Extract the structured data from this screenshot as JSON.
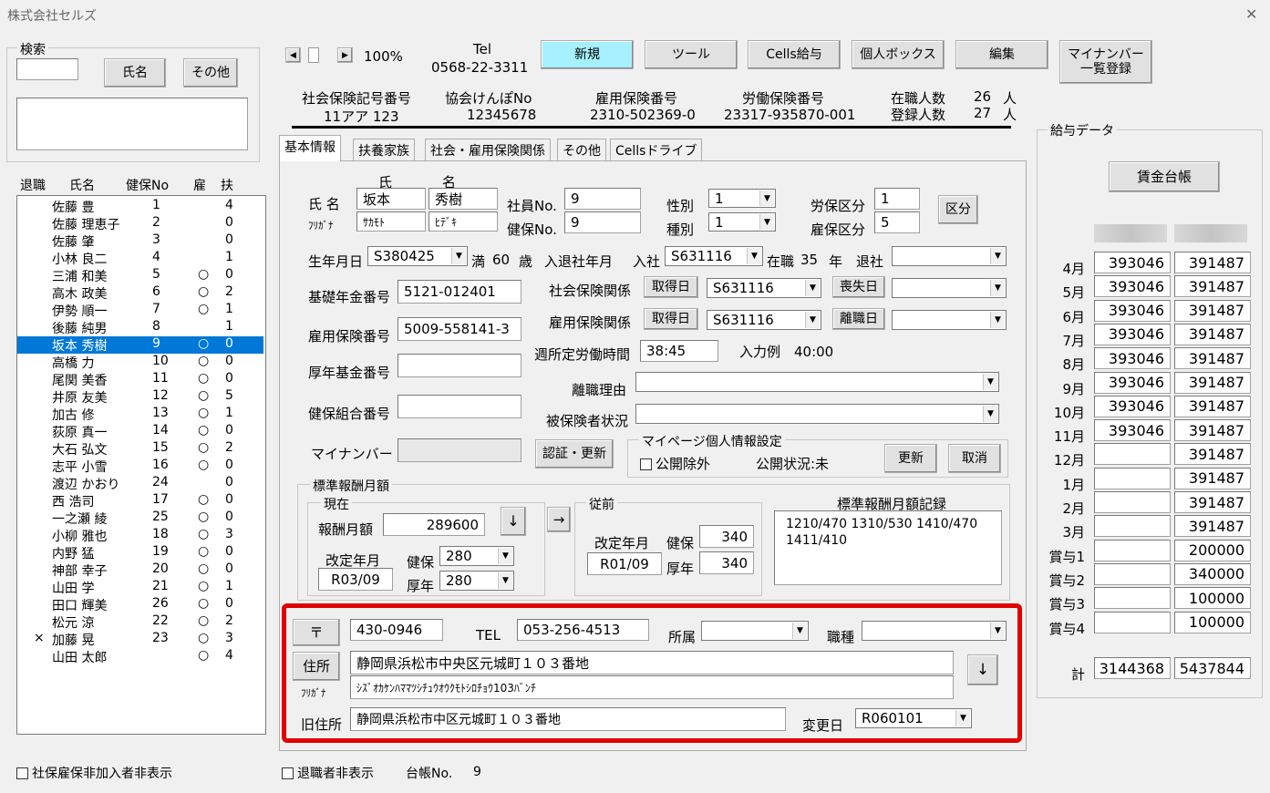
{
  "window": {
    "title": "株式会社セルズ",
    "close": "✕"
  },
  "search": {
    "title": "検索",
    "name_btn": "氏名",
    "other_btn": "その他",
    "input": ""
  },
  "list": {
    "headers": [
      "退職",
      "氏名",
      "健保No",
      "雇",
      "扶"
    ],
    "rows": [
      {
        "ret": "",
        "name": "佐藤 豊",
        "no": "1",
        "emp": "",
        "dep": "4"
      },
      {
        "ret": "",
        "name": "佐藤 理恵子",
        "no": "2",
        "emp": "",
        "dep": "0"
      },
      {
        "ret": "",
        "name": "佐藤 肇",
        "no": "3",
        "emp": "",
        "dep": "0"
      },
      {
        "ret": "",
        "name": "小林 良二",
        "no": "4",
        "emp": "",
        "dep": "1"
      },
      {
        "ret": "",
        "name": "三浦 和美",
        "no": "5",
        "emp": "○",
        "dep": "0"
      },
      {
        "ret": "",
        "name": "高木 政美",
        "no": "6",
        "emp": "○",
        "dep": "2"
      },
      {
        "ret": "",
        "name": "伊勢 順一",
        "no": "7",
        "emp": "○",
        "dep": "1"
      },
      {
        "ret": "",
        "name": "後藤 純男",
        "no": "8",
        "emp": "",
        "dep": "1"
      },
      {
        "ret": "",
        "name": "坂本 秀樹",
        "no": "9",
        "emp": "○",
        "dep": "0"
      },
      {
        "ret": "",
        "name": "高橋 力",
        "no": "10",
        "emp": "○",
        "dep": "0"
      },
      {
        "ret": "",
        "name": "尾関 美香",
        "no": "11",
        "emp": "○",
        "dep": "0"
      },
      {
        "ret": "",
        "name": "井原 友美",
        "no": "12",
        "emp": "○",
        "dep": "5"
      },
      {
        "ret": "",
        "name": "加古 修",
        "no": "13",
        "emp": "○",
        "dep": "1"
      },
      {
        "ret": "",
        "name": "荻原 真一",
        "no": "14",
        "emp": "○",
        "dep": "0"
      },
      {
        "ret": "",
        "name": "大石 弘文",
        "no": "15",
        "emp": "○",
        "dep": "2"
      },
      {
        "ret": "",
        "name": "志平 小雪",
        "no": "16",
        "emp": "○",
        "dep": "0"
      },
      {
        "ret": "",
        "name": "渡辺 かおり",
        "no": "24",
        "emp": "",
        "dep": "0"
      },
      {
        "ret": "",
        "name": "西 浩司",
        "no": "17",
        "emp": "○",
        "dep": "0"
      },
      {
        "ret": "",
        "name": "一之瀬 綾",
        "no": "25",
        "emp": "○",
        "dep": "0"
      },
      {
        "ret": "",
        "name": "小柳 雅也",
        "no": "18",
        "emp": "○",
        "dep": "3"
      },
      {
        "ret": "",
        "name": "内野 猛",
        "no": "19",
        "emp": "○",
        "dep": "0"
      },
      {
        "ret": "",
        "name": "神部 幸子",
        "no": "20",
        "emp": "○",
        "dep": "0"
      },
      {
        "ret": "",
        "name": "山田 学",
        "no": "21",
        "emp": "○",
        "dep": "1"
      },
      {
        "ret": "",
        "name": "田口 輝美",
        "no": "26",
        "emp": "○",
        "dep": "0"
      },
      {
        "ret": "",
        "name": "松元 涼",
        "no": "22",
        "emp": "○",
        "dep": "2"
      },
      {
        "ret": "×",
        "name": "加藤 晃",
        "no": "23",
        "emp": "○",
        "dep": "3"
      },
      {
        "ret": "",
        "name": "山田 太郎",
        "no": "",
        "emp": "○",
        "dep": "4"
      }
    ],
    "selected_index": 8
  },
  "bottom": {
    "hide_insured": "社保雇保非加入者非表示",
    "hide_retired": "退職者非表示",
    "ledger_label": "台帳No.",
    "ledger_no": "9"
  },
  "toolbar": {
    "zoom": "100%",
    "tel_label": "Tel",
    "tel": "0568-22-3311",
    "new": "新規",
    "tool": "ツール",
    "cells": "Cells給与",
    "personal": "個人ボックス",
    "edit": "編集",
    "mynumber": "マイナンバー\n一覧登録"
  },
  "company": {
    "sis_label": "社会保険記号番号",
    "sis": "11アア 123",
    "kenpo_label": "協会けんぽNo",
    "kenpo": "12345678",
    "koyo_label": "雇用保険番号",
    "koyo": "2310-502369-0",
    "rodo_label": "労働保険番号",
    "rodo": "23317-935870-001",
    "enrolled_label": "在職人数",
    "enrolled": "26",
    "registered_label": "登録人数",
    "registered": "27",
    "unit": "人"
  },
  "tabs": [
    "基本情報",
    "扶養家族",
    "社会・雇用保険関係",
    "その他",
    "Cellsドライブ"
  ],
  "basic": {
    "col_sei": "氏",
    "col_mei": "名",
    "name_label": "氏 名",
    "furi_label": "ﾌﾘｶﾞﾅ",
    "sei": "坂本",
    "mei": "秀樹",
    "sei_kana": "ｻｶﾓﾄ",
    "mei_kana": "ﾋﾃﾞｷ",
    "empno_label": "社員No.",
    "empno": "9",
    "kenpono_label": "健保No.",
    "kenpono": "9",
    "sex_label": "性別",
    "sex": "1",
    "kind_label": "種別",
    "kind": "1",
    "rodo_kbn_label": "労保区分",
    "rodo_kbn": "1",
    "koyo_kbn_label": "雇保区分",
    "koyo_kbn": "5",
    "kubun_btn": "区分",
    "birth_label": "生年月日",
    "birth": "S380425",
    "age_pre": "満",
    "age": "60",
    "age_unit": "歳",
    "join_label": "入退社年月",
    "join_pre": "入社",
    "join": "S631116",
    "years_pre": "在職",
    "years": "35",
    "years_unit": "年",
    "retire_label": "退社",
    "retire": "",
    "pension_label": "基礎年金番号",
    "pension": "5121-012401",
    "koyono_label": "雇用保険番号",
    "koyono": "5009-558141-3",
    "kosei_label": "厚年基金番号",
    "kosei": "",
    "kumiai_label": "健保組合番号",
    "kumiai": "",
    "mynum_label": "マイナンバー",
    "mynum": "",
    "auth_btn": "認証・更新",
    "shaho_label": "社会保険関係",
    "shaho_get": "取得日",
    "shaho_date": "S631116",
    "shaho_lost": "喪失日",
    "koyoh_label": "雇用保険関係",
    "koyoh_get": "取得日",
    "koyoh_date": "S631116",
    "koyoh_leave": "離職日",
    "hours_label": "週所定労働時間",
    "hours": "38:45",
    "hours_example": "入力例　40:00",
    "reason_label": "離職理由",
    "status_label": "被保険者状況",
    "mypage_title": "マイページ個人情報設定",
    "public_ex": "公開除外",
    "public_status": "公開状況:未",
    "update_btn": "更新",
    "cancel_btn": "取消"
  },
  "salary": {
    "title": "標準報酬月額",
    "cur_title": "現在",
    "pay_label": "報酬月額",
    "pay": "289600",
    "rev_label": "改定年月",
    "rev": "R03/09",
    "kenpo_label": "健保",
    "kenpo": "280",
    "kosei_label": "厚年",
    "kosei": "280",
    "prev_title": "従前",
    "prev_rev_label": "改定年月",
    "prev_rev": "R01/09",
    "prev_kenpo_label": "健保",
    "prev_kenpo": "340",
    "prev_kosei_label": "厚年",
    "prev_kosei": "340",
    "record_title": "標準報酬月額記録",
    "record": "1210/470 1310/530 1410/470 1411/410",
    "down": "↓",
    "right": "→"
  },
  "address": {
    "zip_btn": "〒",
    "zip": "430-0946",
    "tel_label": "TEL",
    "tel": "053-256-4513",
    "dept_label": "所属",
    "job_label": "職種",
    "addr_btn": "住所",
    "addr": "静岡県浜松市中央区元城町１０３番地",
    "furi_label": "ﾌﾘｶﾞﾅ",
    "addr_kana": "ｼｽﾞｵｶｹﾝﾊﾏﾏﾂｼﾁｭｳｵｳｸﾓﾄｼﾛﾁｮｳ103ﾊﾞﾝﾁ",
    "old_label": "旧住所",
    "old": "静岡県浜松市中区元城町１０３番地",
    "change_label": "変更日",
    "change": "R060101",
    "down": "↓"
  },
  "pay": {
    "title": "給与データ",
    "ledger_btn": "賃金台帳",
    "rows": [
      {
        "m": "4月",
        "a": "393046",
        "b": "391487"
      },
      {
        "m": "5月",
        "a": "393046",
        "b": "391487"
      },
      {
        "m": "6月",
        "a": "393046",
        "b": "391487"
      },
      {
        "m": "7月",
        "a": "393046",
        "b": "391487"
      },
      {
        "m": "8月",
        "a": "393046",
        "b": "391487"
      },
      {
        "m": "9月",
        "a": "393046",
        "b": "391487"
      },
      {
        "m": "10月",
        "a": "393046",
        "b": "391487"
      },
      {
        "m": "11月",
        "a": "393046",
        "b": "391487"
      },
      {
        "m": "12月",
        "a": "",
        "b": "391487"
      },
      {
        "m": "1月",
        "a": "",
        "b": "391487"
      },
      {
        "m": "2月",
        "a": "",
        "b": "391487"
      },
      {
        "m": "3月",
        "a": "",
        "b": "391487"
      },
      {
        "m": "賞与1",
        "a": "",
        "b": "200000"
      },
      {
        "m": "賞与2",
        "a": "",
        "b": "340000"
      },
      {
        "m": "賞与3",
        "a": "",
        "b": "100000"
      },
      {
        "m": "賞与4",
        "a": "",
        "b": "100000"
      }
    ],
    "total_label": "計",
    "total_a": "3144368",
    "total_b": "5437844"
  },
  "colors": {
    "highlight": "#e00000",
    "selected": "#0078d7",
    "new_button": "#a6f0ff"
  }
}
